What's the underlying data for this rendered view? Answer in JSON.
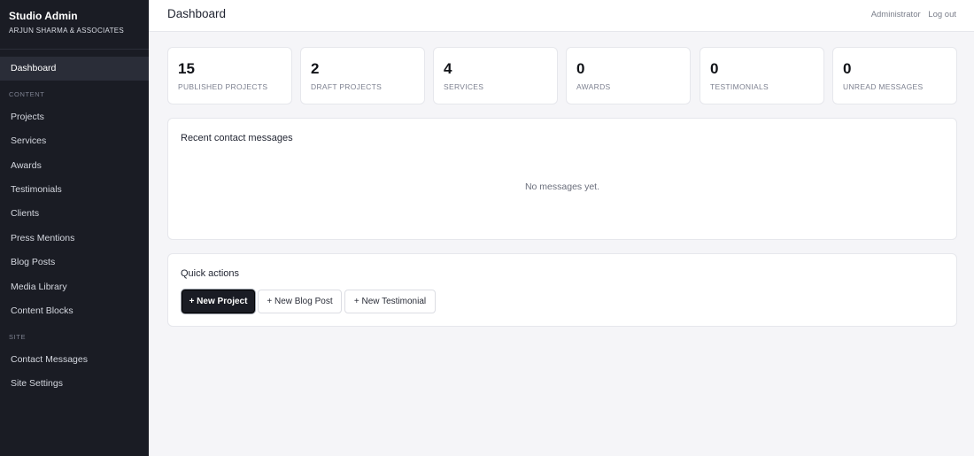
{
  "brand": {
    "title": "Studio Admin",
    "subtitle": "ARJUN SHARMA & ASSOCIATES"
  },
  "sidebar": {
    "dashboard": "Dashboard",
    "content_section": "CONTENT",
    "content_items": [
      "Projects",
      "Services",
      "Awards",
      "Testimonials",
      "Clients",
      "Press Mentions",
      "Blog Posts",
      "Media Library",
      "Content Blocks"
    ],
    "site_section": "SITE",
    "site_items": [
      "Contact Messages",
      "Site Settings"
    ]
  },
  "header": {
    "title": "Dashboard",
    "user": "Administrator",
    "logout": "Log out"
  },
  "stats": [
    {
      "value": "15",
      "label": "PUBLISHED PROJECTS"
    },
    {
      "value": "2",
      "label": "DRAFT PROJECTS"
    },
    {
      "value": "4",
      "label": "SERVICES"
    },
    {
      "value": "0",
      "label": "AWARDS"
    },
    {
      "value": "0",
      "label": "TESTIMONIALS"
    },
    {
      "value": "0",
      "label": "UNREAD MESSAGES"
    }
  ],
  "messages": {
    "title": "Recent contact messages",
    "empty": "No messages yet."
  },
  "quick_actions": {
    "title": "Quick actions",
    "new_project": "+ New Project",
    "new_blog_post": "+ New Blog Post",
    "new_testimonial": "+ New Testimonial"
  },
  "colors": {
    "sidebar_bg": "#1a1c24",
    "sidebar_active": "#2a2d38",
    "page_bg": "#f5f5f8",
    "primary_button": "#1a1c24"
  }
}
